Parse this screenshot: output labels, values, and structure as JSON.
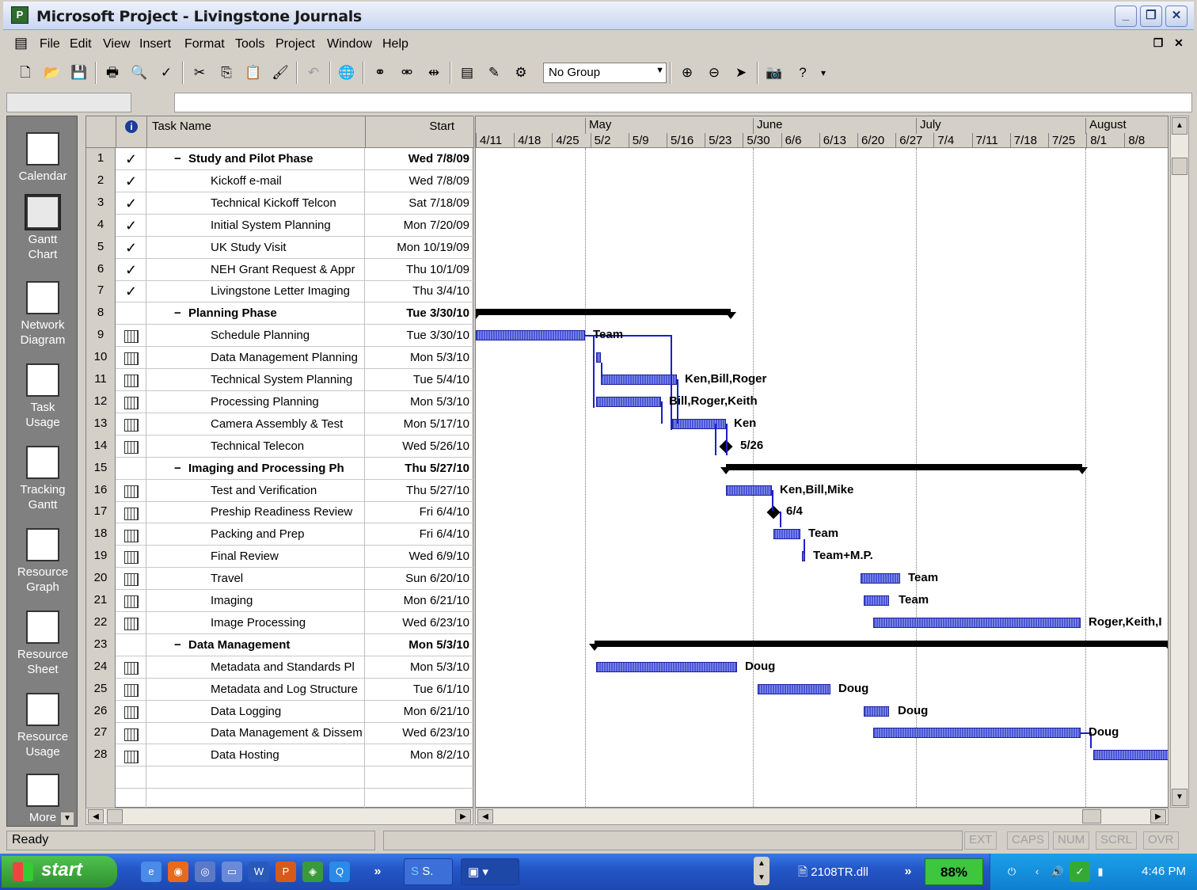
{
  "window": {
    "title": "Microsoft Project - Livingstone Journals"
  },
  "menu": [
    "File",
    "Edit",
    "View",
    "Insert",
    "Format",
    "Tools",
    "Project",
    "Window",
    "Help"
  ],
  "toolbar": {
    "group_value": "No Group"
  },
  "view_bar": [
    {
      "label": "Calendar"
    },
    {
      "label": "Gantt Chart"
    },
    {
      "label": "Network Diagram"
    },
    {
      "label": "Task Usage"
    },
    {
      "label": "Tracking Gantt"
    },
    {
      "label": "Resource Graph"
    },
    {
      "label": "Resource Sheet"
    },
    {
      "label": "Resource Usage"
    },
    {
      "label": "More"
    }
  ],
  "sheet": {
    "col_info_icon": "info-icon",
    "col_task_name": "Task Name",
    "col_start": "Start",
    "rows": [
      {
        "id": "1",
        "ind": "check",
        "name": "Study and Pilot Phase",
        "start": "Wed 7/8/09",
        "summary": true
      },
      {
        "id": "2",
        "ind": "check",
        "name": "Kickoff e-mail",
        "start": "Wed 7/8/09",
        "summary": false
      },
      {
        "id": "3",
        "ind": "check",
        "name": "Technical Kickoff Telcon",
        "start": "Sat 7/18/09",
        "summary": false
      },
      {
        "id": "4",
        "ind": "check",
        "name": "Initial System Planning",
        "start": "Mon 7/20/09",
        "summary": false
      },
      {
        "id": "5",
        "ind": "check",
        "name": "UK Study Visit",
        "start": "Mon 10/19/09",
        "summary": false
      },
      {
        "id": "6",
        "ind": "check",
        "name": "NEH Grant Request & Appr",
        "start": "Thu 10/1/09",
        "summary": false
      },
      {
        "id": "7",
        "ind": "check",
        "name": "Livingstone Letter Imaging",
        "start": "Thu 3/4/10",
        "summary": false
      },
      {
        "id": "8",
        "ind": "",
        "name": "Planning Phase",
        "start": "Tue 3/30/10",
        "summary": true
      },
      {
        "id": "9",
        "ind": "cal",
        "name": "Schedule Planning",
        "start": "Tue 3/30/10",
        "summary": false
      },
      {
        "id": "10",
        "ind": "cal",
        "name": "Data Management Planning",
        "start": "Mon 5/3/10",
        "summary": false
      },
      {
        "id": "11",
        "ind": "cal",
        "name": "Technical System Planning",
        "start": "Tue 5/4/10",
        "summary": false
      },
      {
        "id": "12",
        "ind": "cal",
        "name": "Processing Planning",
        "start": "Mon 5/3/10",
        "summary": false
      },
      {
        "id": "13",
        "ind": "cal",
        "name": "Camera Assembly & Test",
        "start": "Mon 5/17/10",
        "summary": false
      },
      {
        "id": "14",
        "ind": "cal",
        "name": "Technical Telecon",
        "start": "Wed 5/26/10",
        "summary": false
      },
      {
        "id": "15",
        "ind": "",
        "name": "Imaging and Processing Ph",
        "start": "Thu 5/27/10",
        "summary": true
      },
      {
        "id": "16",
        "ind": "cal",
        "name": "Test and Verification",
        "start": "Thu 5/27/10",
        "summary": false
      },
      {
        "id": "17",
        "ind": "cal",
        "name": "Preship Readiness Review",
        "start": "Fri 6/4/10",
        "summary": false
      },
      {
        "id": "18",
        "ind": "cal",
        "name": "Packing and Prep",
        "start": "Fri 6/4/10",
        "summary": false
      },
      {
        "id": "19",
        "ind": "cal",
        "name": "Final Review",
        "start": "Wed 6/9/10",
        "summary": false
      },
      {
        "id": "20",
        "ind": "cal",
        "name": "Travel",
        "start": "Sun 6/20/10",
        "summary": false
      },
      {
        "id": "21",
        "ind": "cal",
        "name": "Imaging",
        "start": "Mon 6/21/10",
        "summary": false
      },
      {
        "id": "22",
        "ind": "cal",
        "name": "Image Processing",
        "start": "Wed 6/23/10",
        "summary": false
      },
      {
        "id": "23",
        "ind": "",
        "name": "Data Management",
        "start": "Mon 5/3/10",
        "summary": true
      },
      {
        "id": "24",
        "ind": "cal",
        "name": "Metadata and Standards Pl",
        "start": "Mon 5/3/10",
        "summary": false
      },
      {
        "id": "25",
        "ind": "cal",
        "name": "Metadata and Log Structure",
        "start": "Tue 6/1/10",
        "summary": false
      },
      {
        "id": "26",
        "ind": "cal",
        "name": "Data Logging",
        "start": "Mon 6/21/10",
        "summary": false
      },
      {
        "id": "27",
        "ind": "cal",
        "name": "Data Management & Dissem",
        "start": "Wed 6/23/10",
        "summary": false
      },
      {
        "id": "28",
        "ind": "cal",
        "name": "Data Hosting",
        "start": "Mon 8/2/10",
        "summary": false
      }
    ]
  },
  "timescale": {
    "months": [
      "May",
      "June",
      "July",
      "August"
    ],
    "weeks": [
      "4/11",
      "4/18",
      "4/25",
      "5/2",
      "5/9",
      "5/16",
      "5/23",
      "5/30",
      "6/6",
      "6/13",
      "6/20",
      "6/27",
      "7/4",
      "7/11",
      "7/18",
      "7/25",
      "8/1",
      "8/8"
    ]
  },
  "gantt_labels": {
    "r9": "Team",
    "r11": "Ken,Bill,Roger",
    "r12": "Bill,Roger,Keith",
    "r13": "Ken",
    "r14": "5/26",
    "r16": "Ken,Bill,Mike",
    "r17": "6/4",
    "r18": "Team",
    "r19": "Team+M.P.",
    "r20": "Team",
    "r21": "Team",
    "r22": "Roger,Keith,I",
    "r24": "Doug",
    "r25": "Doug",
    "r26": "Doug",
    "r27": "Doug"
  },
  "status": {
    "text": "Ready",
    "indicators": [
      "EXT",
      "CAPS",
      "NUM",
      "SCRL",
      "OVR"
    ]
  },
  "taskbar": {
    "start": "start",
    "task1": "S.",
    "task2": "2108TR.dll",
    "battery": "88%",
    "clock": "4:46 PM"
  },
  "colors": {
    "bar": "#4a57d6",
    "link": "#1a1fc8",
    "summary": "#000000"
  }
}
